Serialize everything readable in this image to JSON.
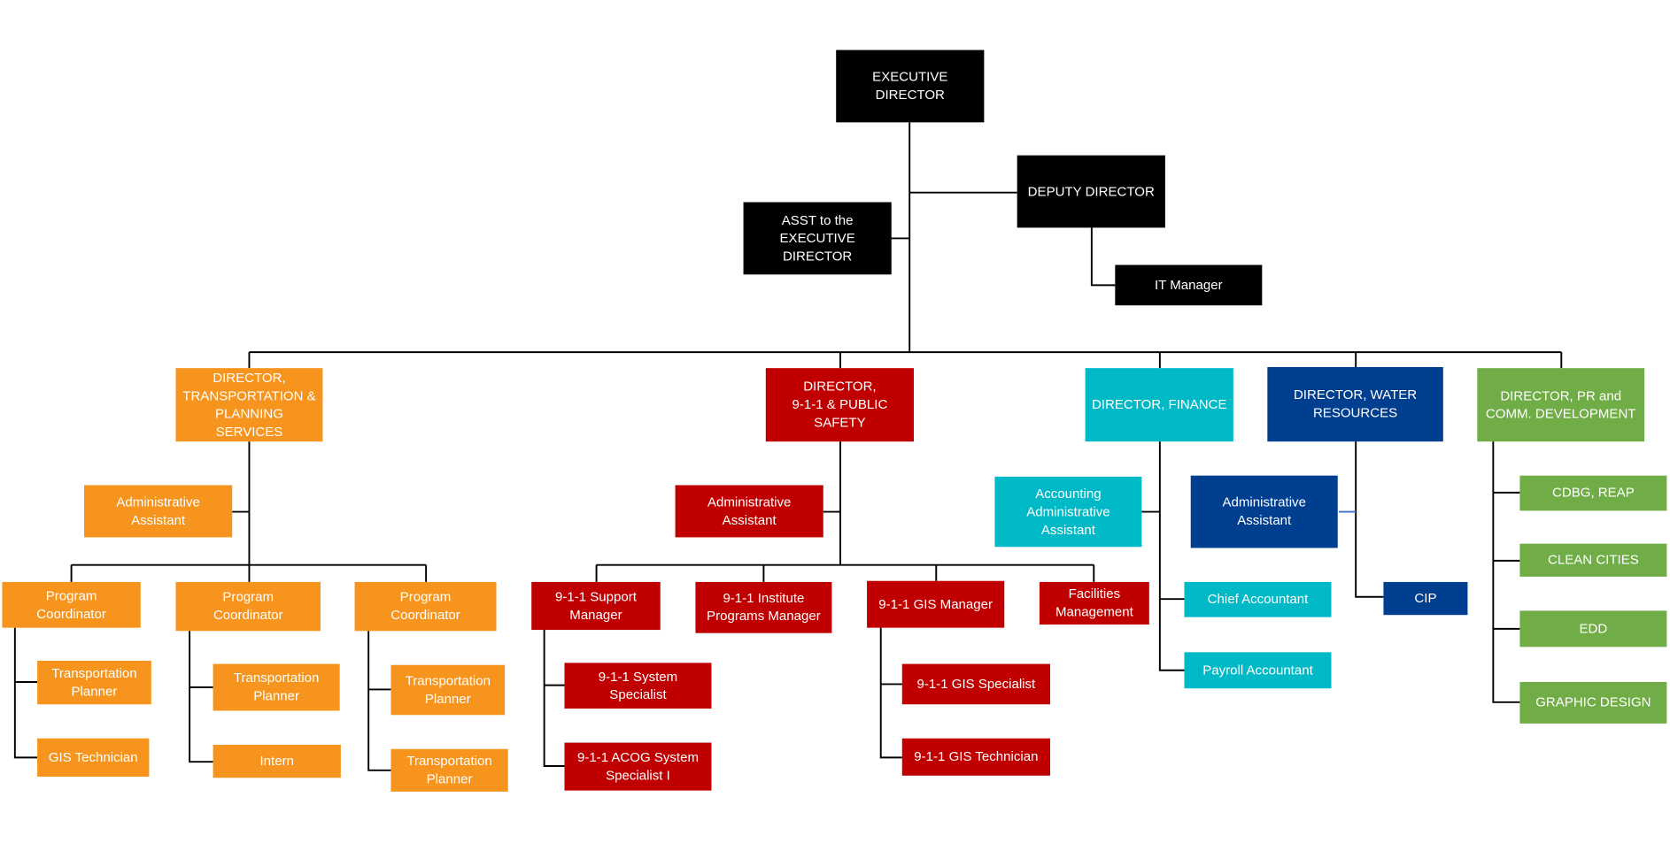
{
  "colors": {
    "black": "#000000",
    "orange": "#F7941D",
    "red": "#C00000",
    "teal": "#00B9C6",
    "blue": "#003E8F",
    "green": "#70AD47",
    "connector": "#000000",
    "connector_accent": "#4472C4"
  },
  "nodes": {
    "executive_director": {
      "label": "EXECUTIVE\nDIRECTOR",
      "color": "black"
    },
    "deputy_director": {
      "label": "DEPUTY DIRECTOR",
      "color": "black"
    },
    "asst_exec": {
      "label": "ASST to the\nEXECUTIVE DIRECTOR",
      "color": "black"
    },
    "it_manager": {
      "label": "IT Manager",
      "color": "black"
    },
    "dir_transportation": {
      "label": "DIRECTOR,\nTRANSPORTATION &\nPLANNING SERVICES",
      "color": "orange"
    },
    "dir_911": {
      "label": "DIRECTOR,\n9-1-1 & PUBLIC\nSAFETY",
      "color": "red"
    },
    "dir_finance": {
      "label": "DIRECTOR, FINANCE",
      "color": "teal"
    },
    "dir_water": {
      "label": "DIRECTOR, WATER\nRESOURCES",
      "color": "blue"
    },
    "dir_pr": {
      "label": "DIRECTOR, PR and\nCOMM. DEVELOPMENT",
      "color": "green"
    },
    "trans_admin": {
      "label": "Administrative\nAssistant",
      "color": "orange"
    },
    "prog_coord_1": {
      "label": "Program\nCoordinator",
      "color": "orange"
    },
    "prog_coord_2": {
      "label": "Program\nCoordinator",
      "color": "orange"
    },
    "prog_coord_3": {
      "label": "Program\nCoordinator",
      "color": "orange"
    },
    "trans_planner_1": {
      "label": "Transportation\nPlanner",
      "color": "orange"
    },
    "gis_tech_1": {
      "label": "GIS Technician",
      "color": "orange"
    },
    "trans_planner_2": {
      "label": "Transportation\nPlanner",
      "color": "orange"
    },
    "intern": {
      "label": "Intern",
      "color": "orange"
    },
    "trans_planner_3": {
      "label": "Transportation\nPlanner",
      "color": "orange"
    },
    "trans_planner_4": {
      "label": "Transportation\nPlanner",
      "color": "orange"
    },
    "ps_admin": {
      "label": "Administrative\nAssistant",
      "color": "red"
    },
    "support_mgr": {
      "label": "9-1-1 Support\nManager",
      "color": "red"
    },
    "institute_mgr": {
      "label": "9-1-1 Institute\nPrograms Manager",
      "color": "red"
    },
    "gis_mgr": {
      "label": "9-1-1 GIS Manager",
      "color": "red"
    },
    "facilities": {
      "label": "Facilities\nManagement",
      "color": "red"
    },
    "system_specialist": {
      "label": "9-1-1 System\nSpecialist",
      "color": "red"
    },
    "acog_specialist": {
      "label": "9-1-1 ACOG System\nSpecialist I",
      "color": "red"
    },
    "gis_specialist": {
      "label": "9-1-1 GIS Specialist",
      "color": "red"
    },
    "gis_tech_911": {
      "label": "9-1-1 GIS Technician",
      "color": "red"
    },
    "acct_admin": {
      "label": "Accounting\nAdministrative\nAssistant",
      "color": "teal"
    },
    "chief_accountant": {
      "label": "Chief Accountant",
      "color": "teal"
    },
    "payroll_accountant": {
      "label": "Payroll Accountant",
      "color": "teal"
    },
    "water_admin": {
      "label": "Administrative\nAssistant",
      "color": "blue"
    },
    "cip": {
      "label": "CIP",
      "color": "blue"
    },
    "cdbg": {
      "label": "CDBG, REAP",
      "color": "green"
    },
    "clean_cities": {
      "label": "CLEAN CITIES",
      "color": "green"
    },
    "edd": {
      "label": "EDD",
      "color": "green"
    },
    "graphic_design": {
      "label": "GRAPHIC DESIGN",
      "color": "green"
    }
  }
}
